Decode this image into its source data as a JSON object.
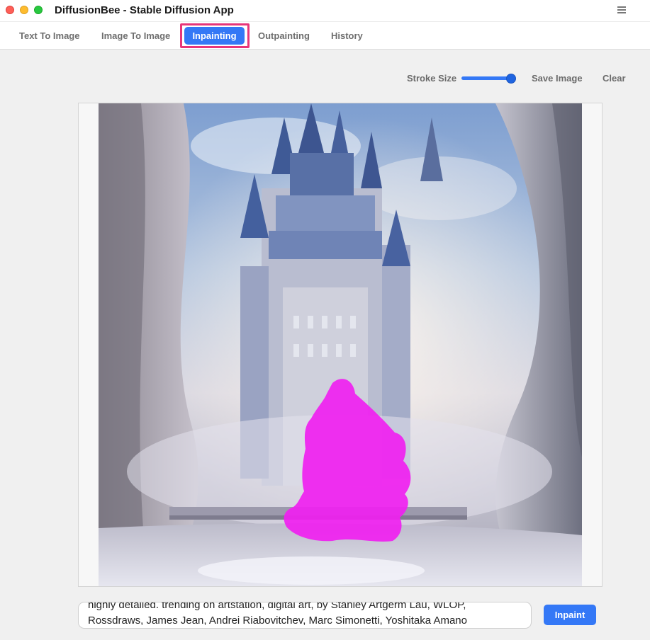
{
  "window": {
    "title": "DiffusionBee - Stable Diffusion App"
  },
  "tabs": [
    {
      "label": "Text To Image",
      "active": false
    },
    {
      "label": "Image To Image",
      "active": false
    },
    {
      "label": "Inpainting",
      "active": true
    },
    {
      "label": "Outpainting",
      "active": false
    },
    {
      "label": "History",
      "active": false
    }
  ],
  "toolbar": {
    "stroke_size_label": "Stroke Size",
    "stroke_size_value": 1.0,
    "save_label": "Save Image",
    "clear_label": "Clear"
  },
  "prompt": {
    "line1": "highly detailed. trending on artstation, digital art, by Stanley Artgerm Lau, WLOP,",
    "line2": "Rossdraws, James Jean, Andrei Riabovitchev, Marc Simonetti, Yoshitaka Amano"
  },
  "actions": {
    "inpaint_label": "Inpaint"
  },
  "colors": {
    "accent": "#3478f6",
    "highlight_outline": "#e8357a",
    "mask": "#f020f0"
  }
}
